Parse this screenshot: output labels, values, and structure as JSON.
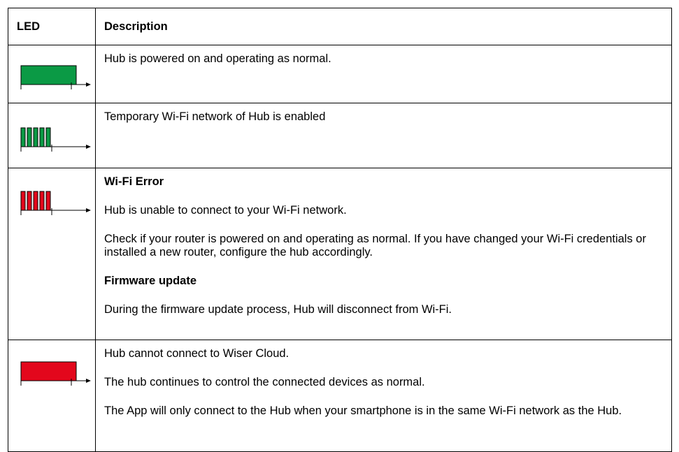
{
  "table": {
    "header": {
      "led": "LED",
      "description": "Description"
    },
    "rows": [
      {
        "led_pattern": "solid-green",
        "paragraphs": [
          {
            "text": "Hub is powered on and operating as normal.",
            "bold": false
          }
        ]
      },
      {
        "led_pattern": "blinking-green",
        "paragraphs": [
          {
            "text": "Temporary Wi-Fi network of Hub is enabled",
            "bold": false
          }
        ]
      },
      {
        "led_pattern": "blinking-red",
        "paragraphs": [
          {
            "text": "Wi-Fi Error",
            "bold": true
          },
          {
            "text": "Hub is unable to connect to your Wi-Fi network.",
            "bold": false
          },
          {
            "text": "Check if your router is powered on and operating as normal. If you have changed your Wi-Fi credentials or installed a new router, configure the hub accordingly.",
            "bold": false
          },
          {
            "text": "Firmware update",
            "bold": true
          },
          {
            "text": "During the firmware update process, Hub will disconnect from Wi-Fi.",
            "bold": false
          }
        ]
      },
      {
        "led_pattern": "solid-red",
        "paragraphs": [
          {
            "text": "Hub cannot connect to Wiser Cloud.",
            "bold": false
          },
          {
            "text": "The hub continues to control the connected devices as normal.",
            "bold": false
          },
          {
            "text": "The App will only connect to the Hub when your smartphone is in the same Wi-Fi network as the Hub.",
            "bold": false
          }
        ]
      }
    ]
  },
  "colors": {
    "green": "#0b9a45",
    "red": "#e3071c",
    "border": "#000000"
  }
}
